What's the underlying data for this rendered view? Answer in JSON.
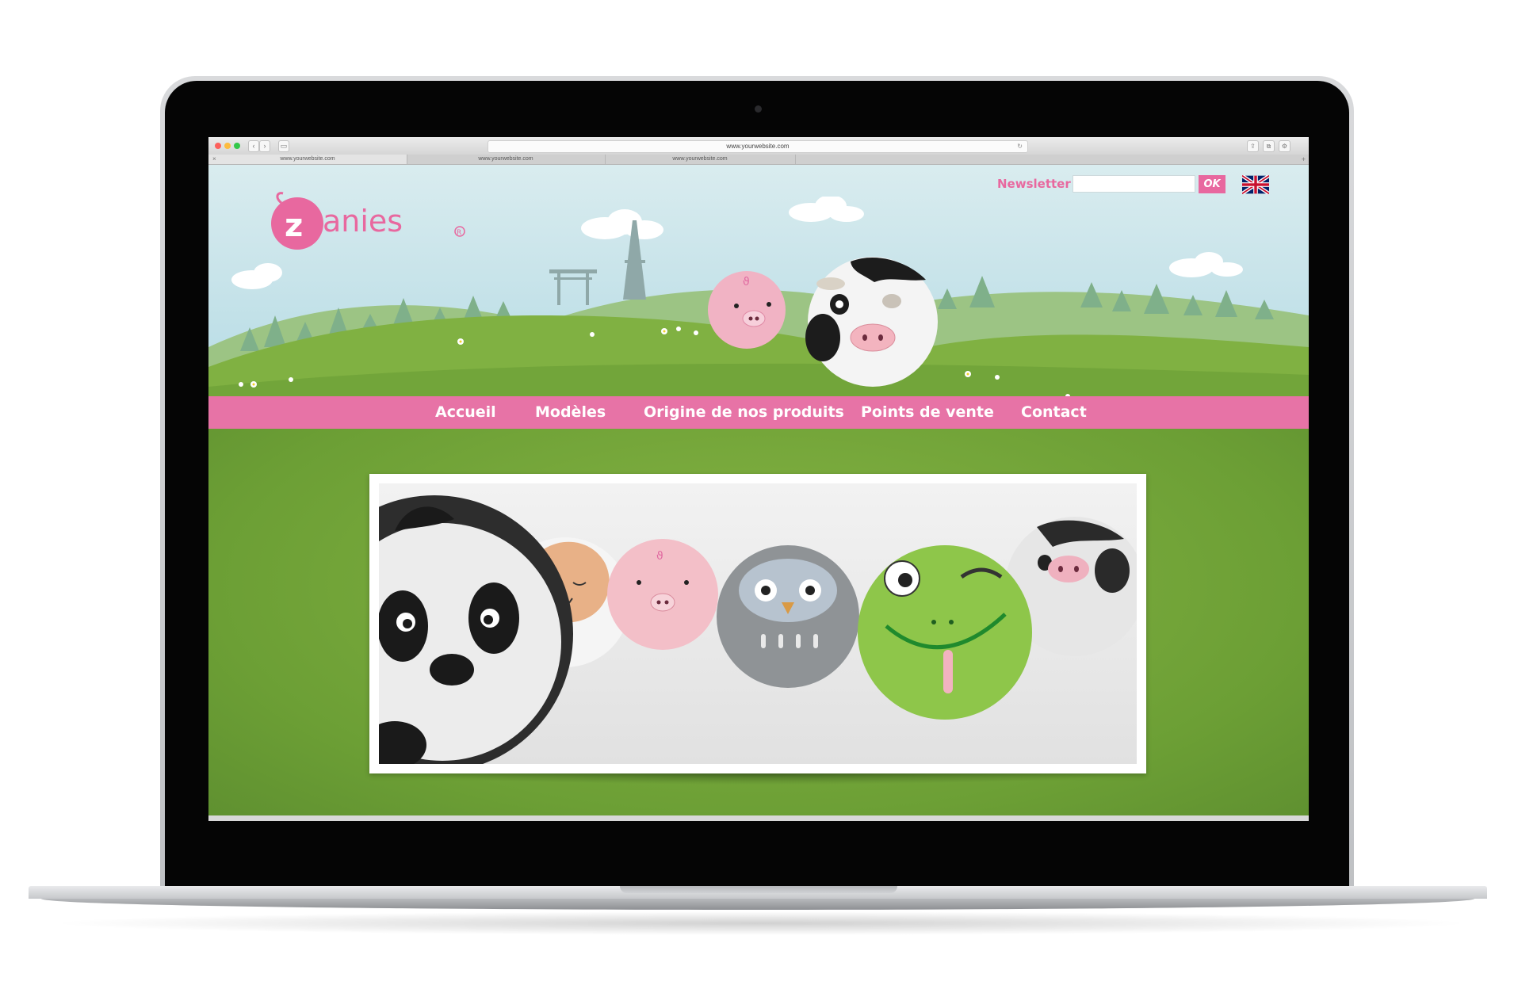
{
  "browser": {
    "url": "www.yourwebsite.com",
    "tabs": [
      {
        "label": "www.yourwebsite.com",
        "active": true
      },
      {
        "label": "www.yourwebsite.com",
        "active": false
      },
      {
        "label": "www.yourwebsite.com",
        "active": false
      }
    ]
  },
  "header": {
    "logo_text": "zanies",
    "newsletter_label": "Newsletter :",
    "newsletter_value": "",
    "ok_label": "OK",
    "language_flag": "uk-flag-icon"
  },
  "nav": {
    "items": [
      {
        "label": "Accueil"
      },
      {
        "label": "Modèles"
      },
      {
        "label": "Origine de nos produits"
      },
      {
        "label": "Points de vente"
      },
      {
        "label": "Contact"
      }
    ]
  },
  "slider": {
    "characters": [
      "panda",
      "sheep",
      "pig",
      "owl",
      "frog",
      "cow"
    ]
  },
  "colors": {
    "brand_pink": "#e8689f",
    "nav_pink": "#e773a6",
    "grass_green": "#7aad3c"
  }
}
